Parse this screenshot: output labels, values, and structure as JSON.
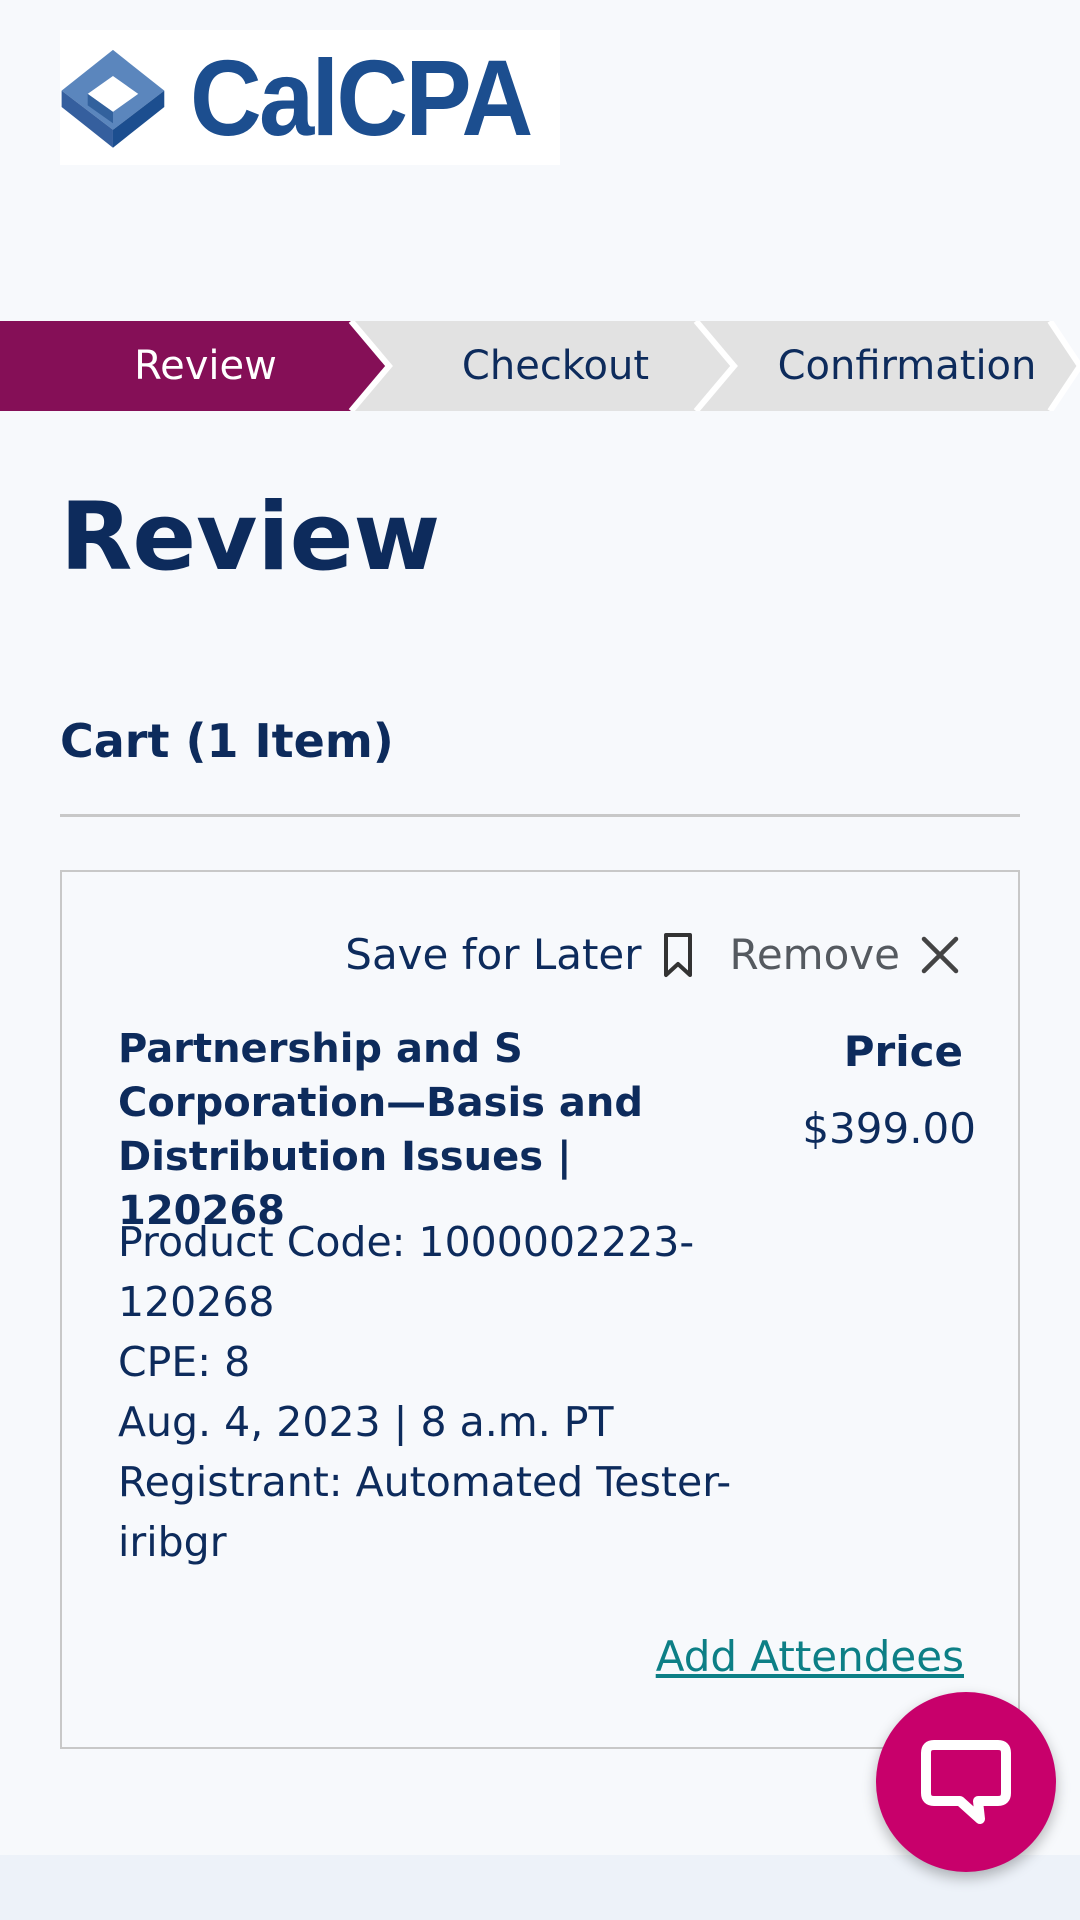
{
  "brand": {
    "logo_text": "CalCPA",
    "primary_color": "#1c4e8f",
    "accent_color": "#850f57"
  },
  "steps": [
    {
      "label": "Review",
      "active": true
    },
    {
      "label": "Checkout",
      "active": false
    },
    {
      "label": "Confirmation",
      "active": false
    }
  ],
  "page": {
    "title": "Review"
  },
  "cart": {
    "heading": "Cart (1 Item)",
    "save_for_later": "Save for Later",
    "save_icon": "bookmark-icon",
    "remove": "Remove",
    "remove_icon": "close-icon",
    "item": {
      "title": "Partnership and S Corporation—Basis and Distribution Issues | 120268",
      "price_label": "Price",
      "price": "$399.00",
      "product_code": "Product Code: 1000002223-120268",
      "cpe": "CPE: 8",
      "date": "Aug. 4, 2023 | 8 a.m. PT",
      "registrant": "Registrant: Automated Tester-iribgr"
    },
    "add_attendees": "Add Attendees"
  },
  "chat": {
    "icon": "chat-bubble-icon",
    "color": "#c8006b"
  }
}
